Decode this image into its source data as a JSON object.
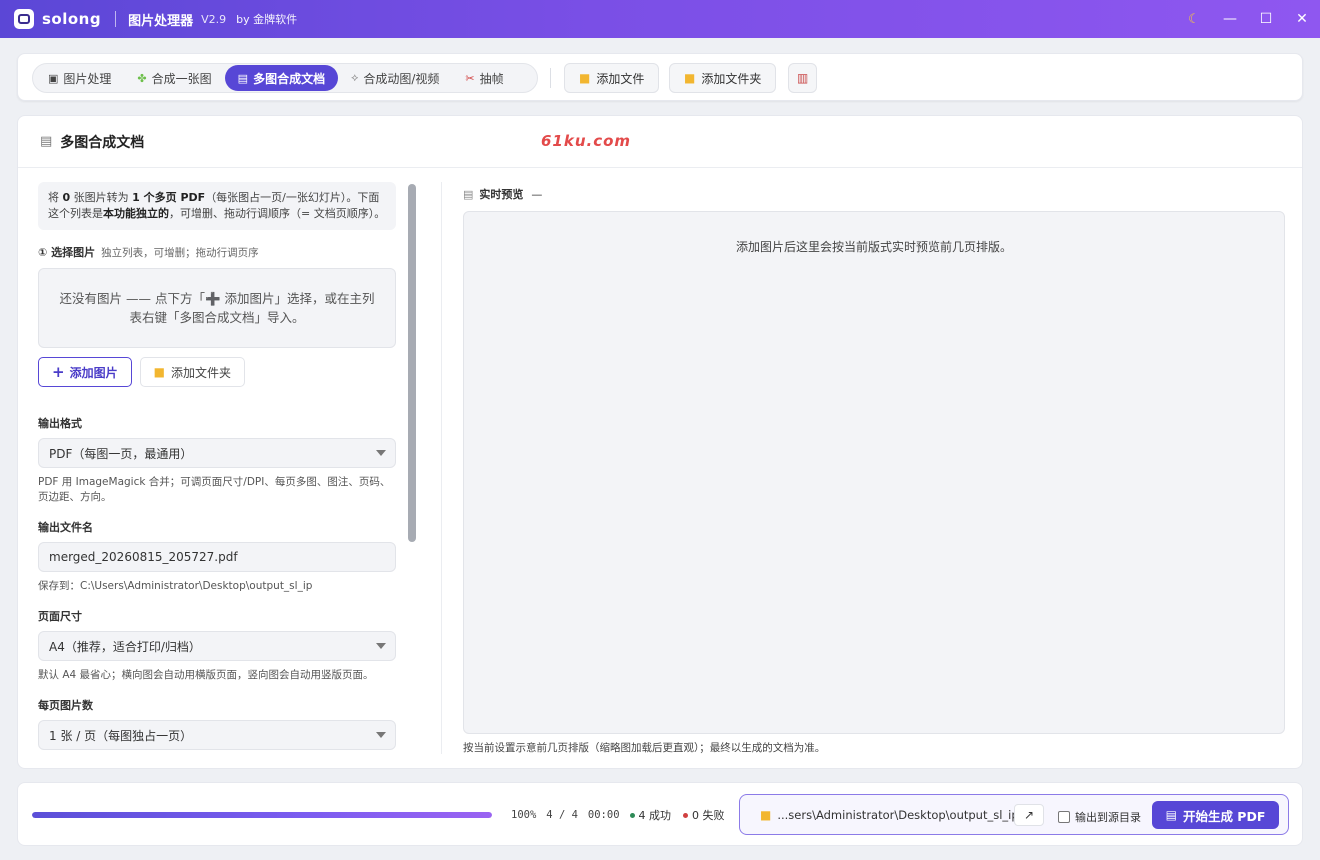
{
  "titlebar": {
    "brand": "solong",
    "title": "图片处理器",
    "version": "V2.9",
    "by": "by 金牌软件"
  },
  "tabs": [
    {
      "label": "图片处理",
      "icon": "image-icon",
      "active": false
    },
    {
      "label": "合成一张图",
      "icon": "puzzle-icon",
      "active": false
    },
    {
      "label": "多图合成文档",
      "icon": "document-icon",
      "active": true
    },
    {
      "label": "合成动图/视频",
      "icon": "link-icon",
      "active": false
    },
    {
      "label": "抽帧",
      "icon": "scissors-icon",
      "active": false
    }
  ],
  "toolbar": {
    "add_file": "添加文件",
    "add_folder": "添加文件夹"
  },
  "main": {
    "title": "多图合成文档",
    "watermark": "61ku.com",
    "info": {
      "p1": "将 ",
      "count": "0",
      "p2": " 张图片转为 ",
      "target": "1 个多页 PDF",
      "p3": "（每张图占一页/一张幻灯片）。下面这个列表是",
      "emph": "本功能独立的",
      "p4": "，可增删、拖动行调顺序（= 文档页顺序）。"
    },
    "select_images": {
      "label": "① 选择图片",
      "sub": "独立列表，可增删；拖动行调页序",
      "empty": "还没有图片 —— 点下方「➕ 添加图片」选择，或在主列表右键「多图合成文档」导入。",
      "add_images": "添加图片",
      "add_folder": "添加文件夹"
    },
    "output_format": {
      "label": "输出格式",
      "value": "PDF（每图一页，最通用）",
      "hint": "PDF 用 ImageMagick 合并；可调页面尺寸/DPI、每页多图、图注、页码、页边距、方向。"
    },
    "output_filename": {
      "label": "输出文件名",
      "value": "merged_20260815_205727.pdf",
      "hint": "保存到：C:\\Users\\Administrator\\Desktop\\output_sl_ip"
    },
    "page_size": {
      "label": "页面尺寸",
      "value": "A4（推荐，适合打印/归档）",
      "hint": "默认 A4 最省心；横向图会自动用横版页面，竖向图会自动用竖版页面。"
    },
    "per_page": {
      "label": "每页图片数",
      "value": "1 张 / 页（每图独占一页）"
    },
    "preview": {
      "label": "实时预览",
      "dash": "—",
      "placeholder": "添加图片后这里会按当前版式实时预览前几页排版。",
      "note": "按当前设置示意前几页排版（缩略图加载后更直观）；最终以生成的文档为准。"
    }
  },
  "bottom": {
    "progress": 1.0,
    "percent": "100%",
    "count": "4 / 4",
    "time": "00:00",
    "success": "4 成功",
    "fail": "0 失败",
    "output_path": "...sers\\Administrator\\Desktop\\output_sl_ip",
    "open_label": "↗",
    "output_to_source": "输出到源目录",
    "start": "开始生成 PDF"
  },
  "colors": {
    "accent": "#5747d6",
    "success": "#2e8b57",
    "fail": "#d04040"
  }
}
